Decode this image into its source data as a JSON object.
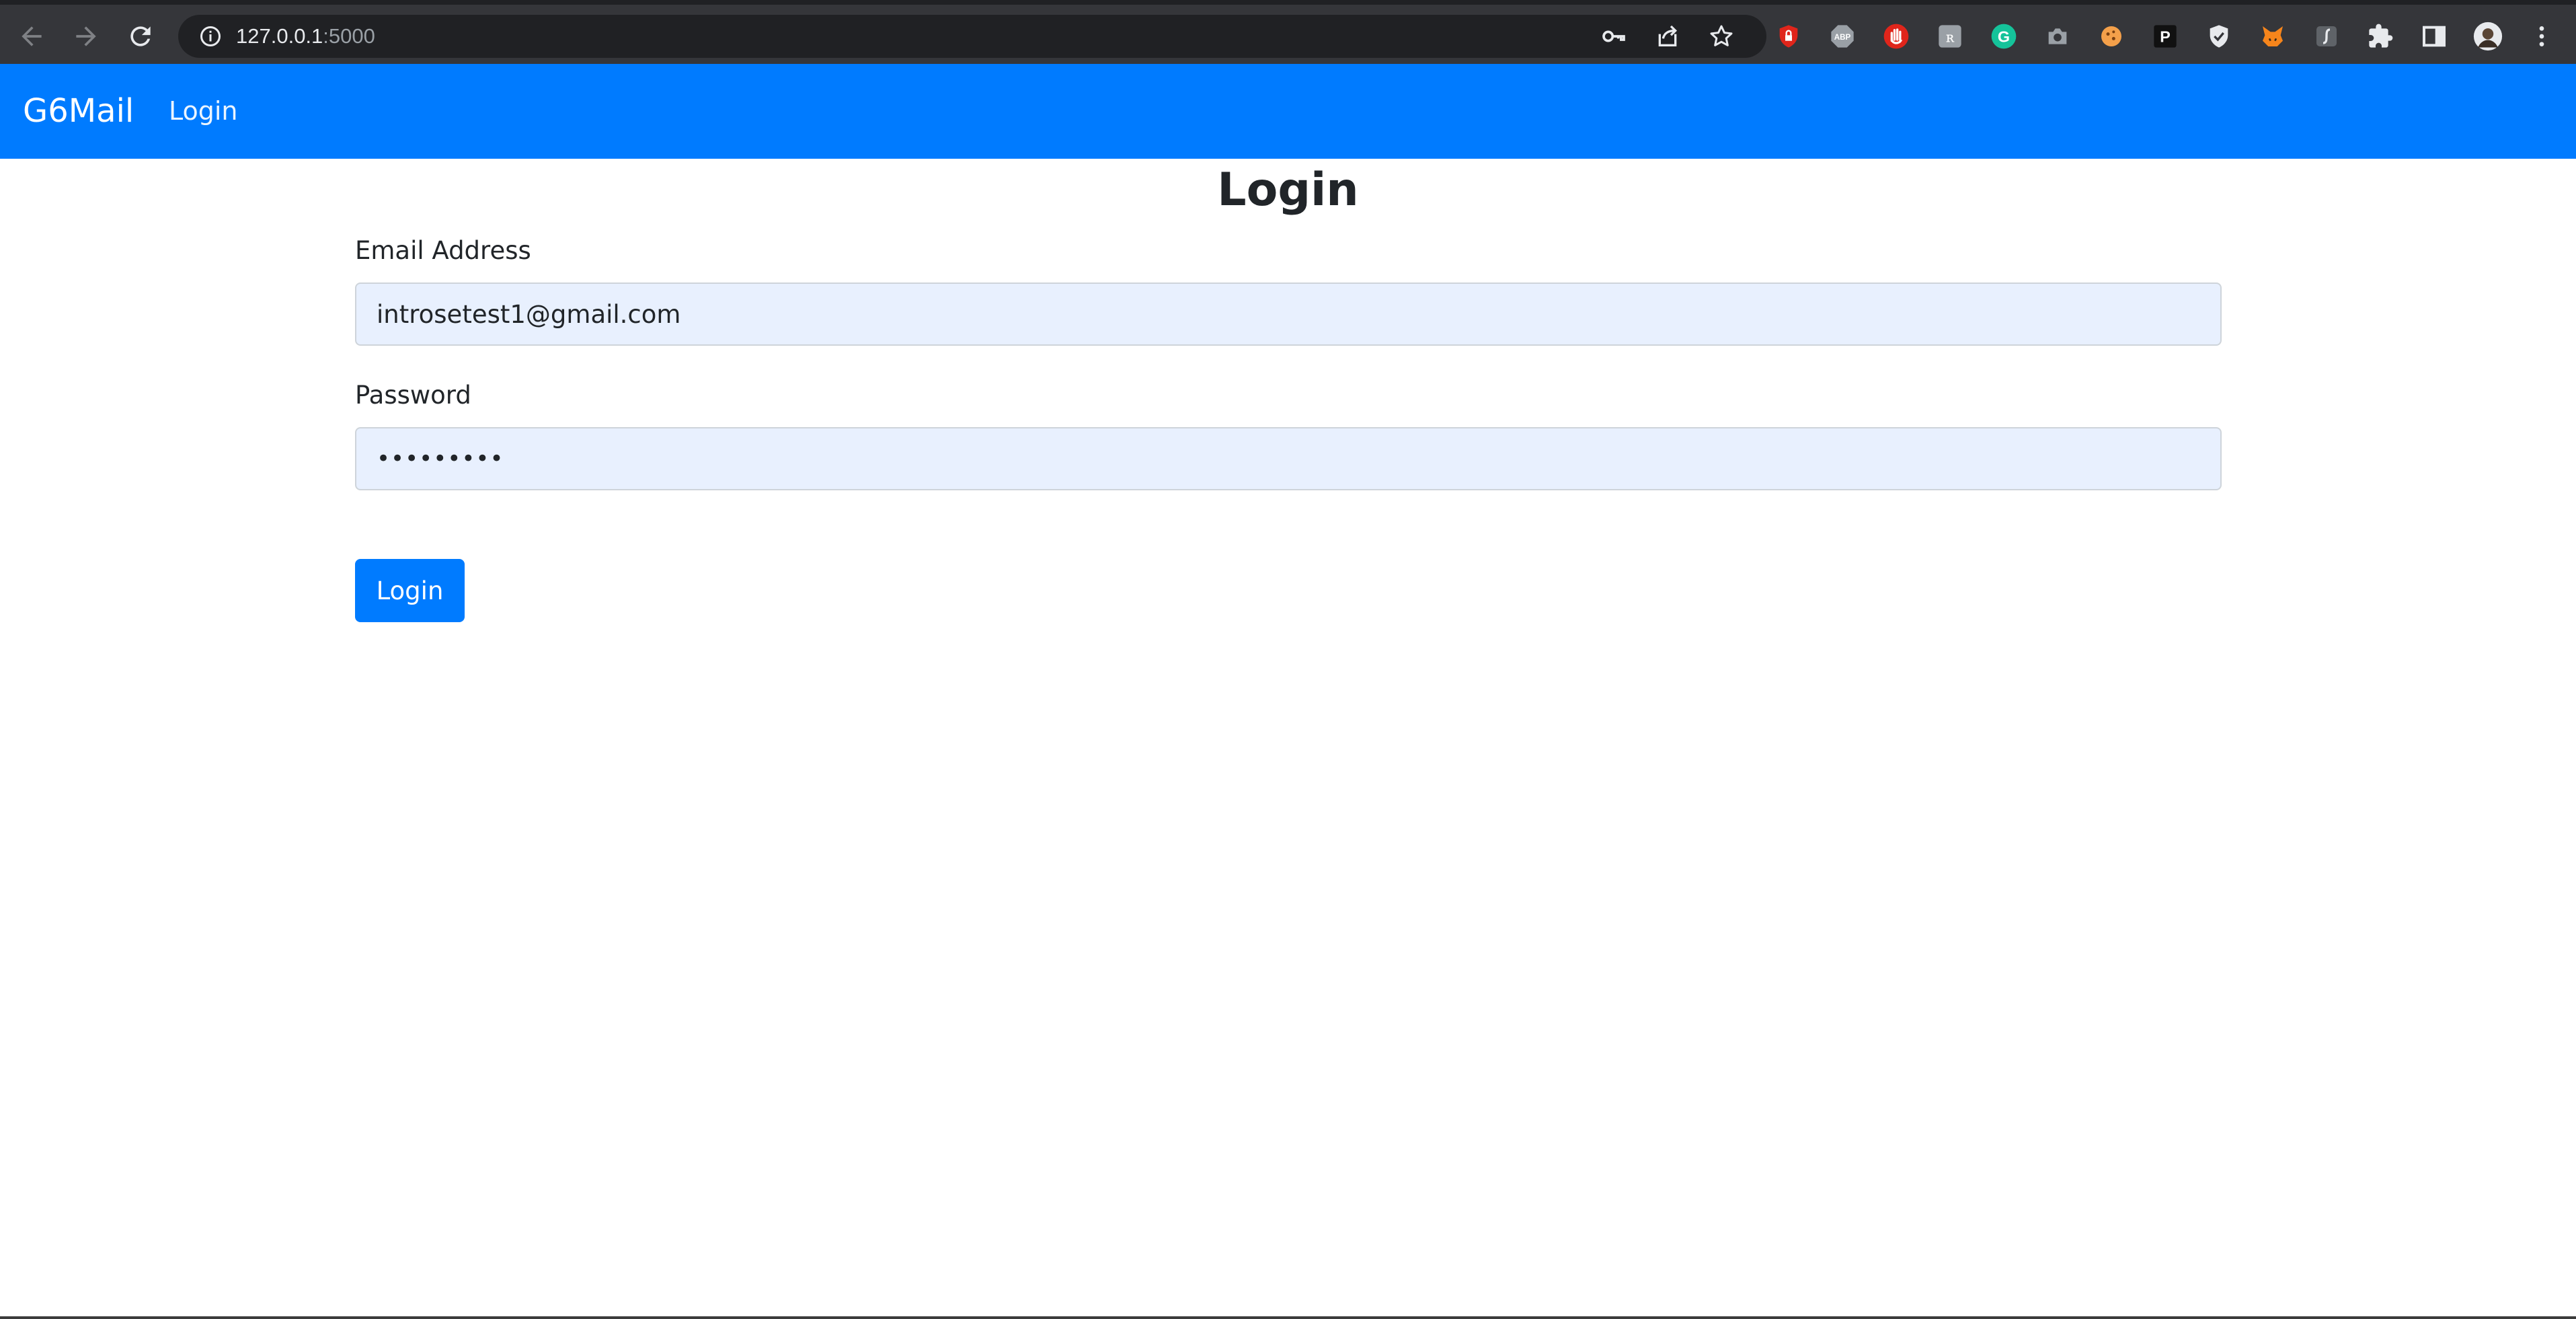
{
  "browser": {
    "url_host": "127.0.0.1",
    "url_port": ":5000",
    "extensions": [
      {
        "icon": "lock-shield-icon",
        "color": "#e0251b"
      },
      {
        "icon": "adblock-plus-icon",
        "label": "ABP",
        "color": "#9aa0a6"
      },
      {
        "icon": "hand-stop-icon",
        "color": "#e0251b"
      },
      {
        "icon": "hoax-extension-icon",
        "color": "#9aa0a6"
      },
      {
        "icon": "grammarly-icon",
        "color": "#15c39a"
      },
      {
        "icon": "camera-icon",
        "color": "#9aa0a6"
      },
      {
        "icon": "cookie-icon",
        "color": "#f4a04a"
      },
      {
        "icon": "p-extension-icon",
        "label": "P",
        "color": "#111111"
      },
      {
        "icon": "shield-check-icon",
        "color": "#e8eaed"
      },
      {
        "icon": "metamask-fox-icon",
        "color": "#f6851b"
      },
      {
        "icon": "script-icon",
        "color": "#9aa0a6"
      },
      {
        "icon": "puzzle-extensions-icon",
        "color": "#e8eaed"
      },
      {
        "icon": "side-panel-icon",
        "color": "#e8eaed"
      },
      {
        "icon": "profile-avatar",
        "color": "#e8eaed"
      },
      {
        "icon": "kebab-menu-icon",
        "color": "#e8eaed"
      }
    ]
  },
  "navbar": {
    "brand": "G6Mail",
    "link_login": "Login",
    "color": "#007bff"
  },
  "form": {
    "title": "Login",
    "email_label": "Email Address",
    "email_value": "introsetest1@gmail.com",
    "password_label": "Password",
    "password_mask": "•••••••••",
    "submit_label": "Login",
    "accent_color": "#007bff",
    "autofill_color": "#e8f0fe"
  }
}
